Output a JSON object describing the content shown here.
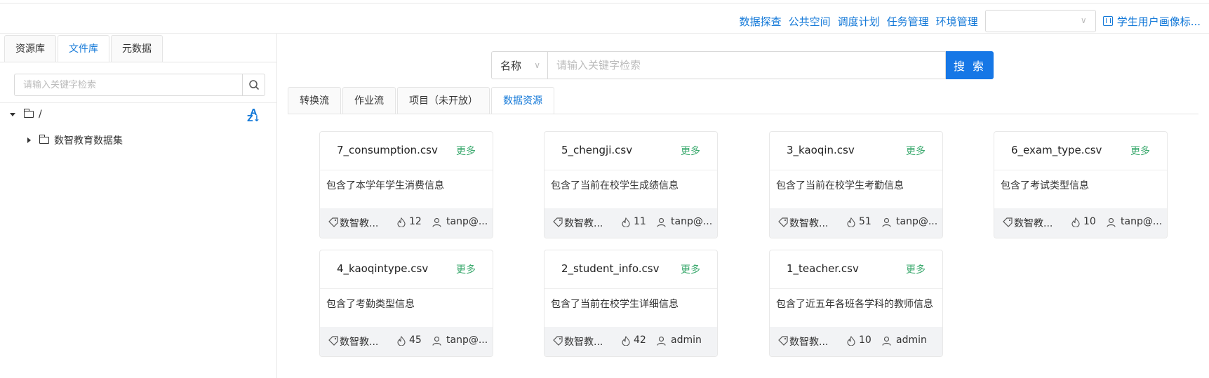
{
  "topnav": {
    "links": [
      "数据探查",
      "公共空间",
      "调度计划",
      "任务管理",
      "环境管理"
    ],
    "select_value": "",
    "profile_label": "学生用户画像标..."
  },
  "left": {
    "tabs": [
      "资源库",
      "文件库",
      "元数据"
    ],
    "active_tab": 1,
    "search_placeholder": "请输入关键字检索",
    "tree_root": "/",
    "tree_child": "数智教育数据集"
  },
  "search": {
    "field": "名称",
    "placeholder": "请输入关键字检索",
    "button": "搜 索"
  },
  "tabs": [
    "转换流",
    "作业流",
    "项目（未开放）",
    "数据资源"
  ],
  "active_tab": 3,
  "cards": [
    {
      "title": "7_consumption.csv",
      "more": "更多",
      "desc": "包含了本学年学生消费信息",
      "tag": "数智教...",
      "count": "12",
      "user": "tanp@..."
    },
    {
      "title": "5_chengji.csv",
      "more": "更多",
      "desc": "包含了当前在校学生成绩信息",
      "tag": "数智教...",
      "count": "11",
      "user": "tanp@..."
    },
    {
      "title": "3_kaoqin.csv",
      "more": "更多",
      "desc": "包含了当前在校学生考勤信息",
      "tag": "数智教...",
      "count": "51",
      "user": "tanp@..."
    },
    {
      "title": "6_exam_type.csv",
      "more": "更多",
      "desc": "包含了考试类型信息",
      "tag": "数智教...",
      "count": "10",
      "user": "tanp@..."
    },
    {
      "title": "4_kaoqintype.csv",
      "more": "更多",
      "desc": "包含了考勤类型信息",
      "tag": "数智教...",
      "count": "45",
      "user": "tanp@..."
    },
    {
      "title": "2_student_info.csv",
      "more": "更多",
      "desc": "包含了当前在校学生详细信息",
      "tag": "数智教...",
      "count": "42",
      "user": "admin"
    },
    {
      "title": "1_teacher.csv",
      "more": "更多",
      "desc": "包含了近五年各班各学科的教师信息",
      "tag": "数智教...",
      "count": "10",
      "user": "admin"
    }
  ]
}
